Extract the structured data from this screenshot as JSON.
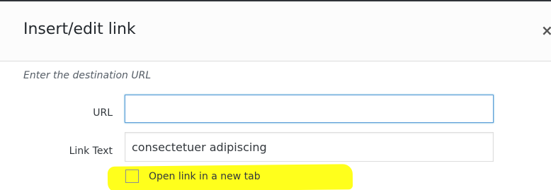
{
  "dialog": {
    "title": "Insert/edit link",
    "close_icon": "×"
  },
  "form": {
    "instructions": "Enter the destination URL",
    "url": {
      "label": "URL",
      "value": ""
    },
    "link_text": {
      "label": "Link Text",
      "value": "consectetuer adipiscing"
    },
    "new_tab": {
      "label": "Open link in a new tab",
      "checked": false
    }
  },
  "colors": {
    "focus_border": "#5b9dd9",
    "highlight": "#ffff1c",
    "text": "#32373c"
  }
}
